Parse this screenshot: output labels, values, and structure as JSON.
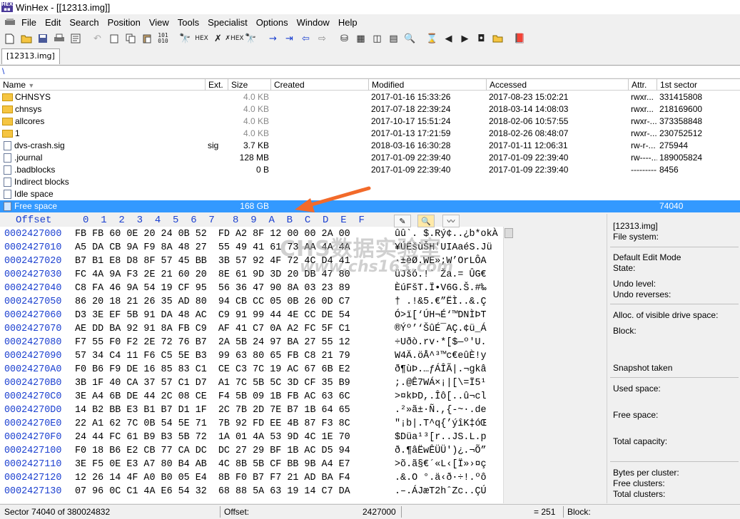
{
  "window": {
    "app_title": "WinHex - [[12313.img]]"
  },
  "menu": [
    "File",
    "Edit",
    "Search",
    "Position",
    "View",
    "Tools",
    "Specialist",
    "Options",
    "Window",
    "Help"
  ],
  "tab": {
    "label": "[12313.img]"
  },
  "path": "\\",
  "dir_columns": [
    "Name",
    "Ext.",
    "Size",
    "Created",
    "Modified",
    "Accessed",
    "Attr.",
    "1st sector"
  ],
  "dir_rows": [
    {
      "name": "CHNSYS",
      "ext": "",
      "size": "4.0 KB",
      "created": "",
      "modified": "2017-01-16  15:33:26",
      "accessed": "2017-08-23  15:02:21",
      "attr": "rwxr...",
      "sector": "331415808",
      "icon": "folder"
    },
    {
      "name": "chnsys",
      "ext": "",
      "size": "4.0 KB",
      "created": "",
      "modified": "2017-07-18  22:39:24",
      "accessed": "2018-03-14  14:08:03",
      "attr": "rwxr...",
      "sector": "218169600",
      "icon": "folder"
    },
    {
      "name": "allcores",
      "ext": "",
      "size": "4.0 KB",
      "created": "",
      "modified": "2017-10-17  15:51:24",
      "accessed": "2018-02-06  10:57:55",
      "attr": "rwxr-...",
      "sector": "373358848",
      "icon": "folder"
    },
    {
      "name": "1",
      "ext": "",
      "size": "4.0 KB",
      "created": "",
      "modified": "2017-01-13  17:21:59",
      "accessed": "2018-02-26  08:48:07",
      "attr": "rwxr-...",
      "sector": "230752512",
      "icon": "folder"
    },
    {
      "name": "dvs-crash.sig",
      "ext": "sig",
      "size": "3.7 KB",
      "created": "",
      "modified": "2018-03-16  16:30:28",
      "accessed": "2017-01-11  12:06:31",
      "attr": "rw-r-...",
      "sector": "275944",
      "icon": "file"
    },
    {
      "name": ".journal",
      "ext": "",
      "size": "128 MB",
      "created": "",
      "modified": "2017-01-09  22:39:40",
      "accessed": "2017-01-09  22:39:40",
      "attr": "rw----...",
      "sector": "189005824",
      "icon": "file"
    },
    {
      "name": ".badblocks",
      "ext": "",
      "size": "0 B",
      "created": "",
      "modified": "2017-01-09  22:39:40",
      "accessed": "2017-01-09  22:39:40",
      "attr": "---------",
      "sector": "8456",
      "icon": "file"
    },
    {
      "name": "Indirect blocks",
      "ext": "",
      "size": "",
      "created": "",
      "modified": "",
      "accessed": "",
      "attr": "",
      "sector": "",
      "icon": "file"
    },
    {
      "name": "Idle space",
      "ext": "",
      "size": "",
      "created": "",
      "modified": "",
      "accessed": "",
      "attr": "",
      "sector": "",
      "icon": "file"
    },
    {
      "name": "Free space",
      "ext": "",
      "size": "168 GB",
      "created": "",
      "modified": "",
      "accessed": "",
      "attr": "",
      "sector": "74040",
      "icon": "file"
    }
  ],
  "hex": {
    "offset_label": "Offset",
    "col_header": "0  1  2  3  4  5  6  7   8  9  A  B  C  D  E  F",
    "rows": [
      {
        "offset": "0002427000",
        "bytes": "FB FB 60 0E 20 24 0B 52  FD A2 8F 12 00 00 2A 00",
        "ascii": "ûû`. $.Rý¢..¿b*okÀ"
      },
      {
        "offset": "0002427010",
        "bytes": "A5 DA CB 9A F9 8A 48 27  55 49 41 61 73 AA 4A 4A",
        "ascii": "¥ÚËšùŠH'UIAaéS.Jü"
      },
      {
        "offset": "0002427020",
        "bytes": "B7 B1 E8 D8 8F 57 45 BB  3B 57 92 4F 72 4C D4 41",
        "ascii": "·±èØ.WE»;W’OrLÔA"
      },
      {
        "offset": "0002427030",
        "bytes": "FC 4A 9A F3 2E 21 60 20  8E 61 9D 3D 20 DB 47 80",
        "ascii": "üJšó.!` Ža.= ÛG€"
      },
      {
        "offset": "0002427040",
        "bytes": "C8 FA 46 9A 54 19 CF 95  56 36 47 90 8A 03 23 89",
        "ascii": "ÈúFšT.Ï•V6G.Š.#‰"
      },
      {
        "offset": "0002427050",
        "bytes": "86 20 18 21 26 35 AD 80  94 CB CC 05 0B 26 0D C7",
        "ascii": "† .!&5.€”ËÌ..&.Ç"
      },
      {
        "offset": "0002427060",
        "bytes": "D3 3E EF 5B 91 DA 48 AC  C9 91 99 44 4E CC DE 54",
        "ascii": "Ó>ï[‘ÚH¬É‘™DNÌÞT"
      },
      {
        "offset": "0002427070",
        "bytes": "AE DD BA 92 91 8A FB C9  AF 41 C7 0A A2 FC 5F C1",
        "ascii": "®Ýº’‘ŠûÉ¯AÇ.¢ü_Á"
      },
      {
        "offset": "0002427080",
        "bytes": "F7 55 F0 F2 2E 72 76 B7  2A 5B 24 97 BA 27 55 12",
        "ascii": "÷Uðò.rv·*[$—º'U."
      },
      {
        "offset": "0002427090",
        "bytes": "57 34 C4 11 F6 C5 5E B3  99 63 80 65 FB C8 21 79",
        "ascii": "W4Ä.öÅ^³™c€eûÈ!y"
      },
      {
        "offset": "00024270A0",
        "bytes": "F0 B6 F9 DE 16 85 83 C1  CE C3 7C 19 AC 67 6B E2",
        "ascii": "ð¶ùÞ.…ƒÁÎÃ|.¬gkâ"
      },
      {
        "offset": "00024270B0",
        "bytes": "3B 1F 40 CA 37 57 C1 D7  A1 7C 5B 5C 3D CF 35 B9",
        "ascii": ";.@Ê7WÁ×¡|[\\=Ï5¹"
      },
      {
        "offset": "00024270C0",
        "bytes": "3E A4 6B DE 44 2C 08 CE  F4 5B 09 1B FB AC 63 6C",
        "ascii": ">¤kÞD,.Îô[..û¬cl"
      },
      {
        "offset": "00024270D0",
        "bytes": "14 B2 BB E3 B1 B7 D1 1F  2C 7B 2D 7E B7 1B 64 65",
        "ascii": ".²»ã±·Ñ.,{-~·.de"
      },
      {
        "offset": "00024270E0",
        "bytes": "22 A1 62 7C 0B 54 5E 71  7B 92 FD EE 4B 87 F3 8C",
        "ascii": "\"¡b|.T^q{’ýîK‡óŒ"
      },
      {
        "offset": "00024270F0",
        "bytes": "24 44 FC 61 B9 B3 5B 72  1A 01 4A 53 9D 4C 1E 70",
        "ascii": "$Düa¹³[r..JS.L.p"
      },
      {
        "offset": "0002427100",
        "bytes": "F0 18 B6 E2 CB 77 CA DC  DC 27 29 BF 1B AC D5 94",
        "ascii": "ð.¶âËwÊÜÜ')¿.¬Õ”"
      },
      {
        "offset": "0002427110",
        "bytes": "3E F5 0E E3 A7 80 B4 AB  4C 8B 5B CF BB 9B A4 E7",
        "ascii": ">õ.ã§€´«L‹[Ï»›¤ç"
      },
      {
        "offset": "0002427120",
        "bytes": "12 26 14 4F A0 B0 05 E4  8B F0 B7 F7 21 AD BA F4",
        "ascii": ".&.O °.ä‹ð·÷!.ºô"
      },
      {
        "offset": "0002427130",
        "bytes": "07 96 0C C1 4A E6 54 32  68 88 5A 63 19 14 C7 DA",
        "ascii": ".–.ÁJæT2hˆZc..ÇÚ"
      }
    ]
  },
  "watermark": {
    "line1": "CHS数据实验室",
    "line2": "www.chs163.com"
  },
  "info": {
    "file": "[12313.img]",
    "file_system": "File system:",
    "edit_mode": "Default Edit Mode",
    "state": "State:",
    "undo_level": "Undo level:",
    "undo_reverses": "Undo reverses:",
    "alloc": "Alloc. of visible drive space:",
    "block": "Block:",
    "snapshot": "Snapshot taken",
    "used_space": "Used space:",
    "free_space": "Free space:",
    "total_capacity": "Total capacity:",
    "bytes_per_cluster": "Bytes per cluster:",
    "free_clusters": "Free clusters:",
    "total_clusters": "Total clusters:"
  },
  "status": {
    "sector": "Sector 74040 of 380024832",
    "offset_label": "Offset:",
    "offset_value": "2427000",
    "value": "= 251",
    "block_label": "Block:"
  },
  "colors": {
    "selection": "#3399ff",
    "offset_blue": "#1a3fd0",
    "arrow": "#f26a2a"
  }
}
